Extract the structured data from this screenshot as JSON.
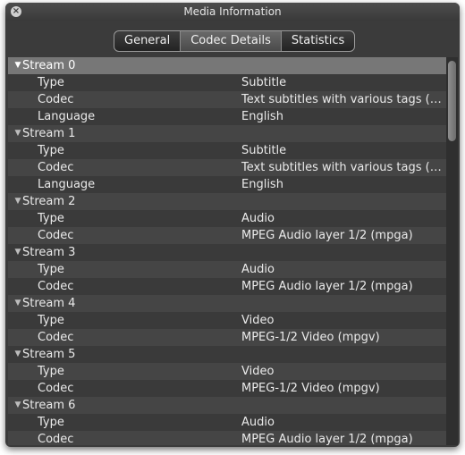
{
  "window": {
    "title": "Media Information"
  },
  "tabs": [
    {
      "label": "General"
    },
    {
      "label": "Codec Details"
    },
    {
      "label": "Statistics"
    }
  ],
  "active_tab": "Codec Details",
  "rows": [
    {
      "kind": "header",
      "label": "Stream 0",
      "selected": true
    },
    {
      "kind": "field",
      "key": "Type",
      "value": "Subtitle"
    },
    {
      "kind": "field",
      "key": "Codec",
      "value": "Text subtitles with various tags (…"
    },
    {
      "kind": "field",
      "key": "Language",
      "value": "English"
    },
    {
      "kind": "header",
      "label": "Stream 1"
    },
    {
      "kind": "field",
      "key": "Type",
      "value": "Subtitle"
    },
    {
      "kind": "field",
      "key": "Codec",
      "value": "Text subtitles with various tags (…"
    },
    {
      "kind": "field",
      "key": "Language",
      "value": "English"
    },
    {
      "kind": "header",
      "label": "Stream 2"
    },
    {
      "kind": "field",
      "key": "Type",
      "value": "Audio"
    },
    {
      "kind": "field",
      "key": "Codec",
      "value": "MPEG Audio layer 1/2 (mpga)"
    },
    {
      "kind": "header",
      "label": "Stream 3"
    },
    {
      "kind": "field",
      "key": "Type",
      "value": "Audio"
    },
    {
      "kind": "field",
      "key": "Codec",
      "value": "MPEG Audio layer 1/2 (mpga)"
    },
    {
      "kind": "header",
      "label": "Stream 4"
    },
    {
      "kind": "field",
      "key": "Type",
      "value": "Video"
    },
    {
      "kind": "field",
      "key": "Codec",
      "value": "MPEG-1/2 Video (mpgv)"
    },
    {
      "kind": "header",
      "label": "Stream 5"
    },
    {
      "kind": "field",
      "key": "Type",
      "value": "Video"
    },
    {
      "kind": "field",
      "key": "Codec",
      "value": "MPEG-1/2 Video (mpgv)"
    },
    {
      "kind": "header",
      "label": "Stream 6"
    },
    {
      "kind": "field",
      "key": "Type",
      "value": "Audio"
    },
    {
      "kind": "field",
      "key": "Codec",
      "value": "MPEG Audio layer 1/2 (mpga)"
    }
  ],
  "icons": {
    "close": "close-icon",
    "expanded": "disclosure-triangle-expanded-icon"
  },
  "glyphs": {
    "close": "×",
    "triangle": "▼"
  },
  "colors": {
    "selected_row": "#777777",
    "window_bg": "#3b3b3b"
  }
}
